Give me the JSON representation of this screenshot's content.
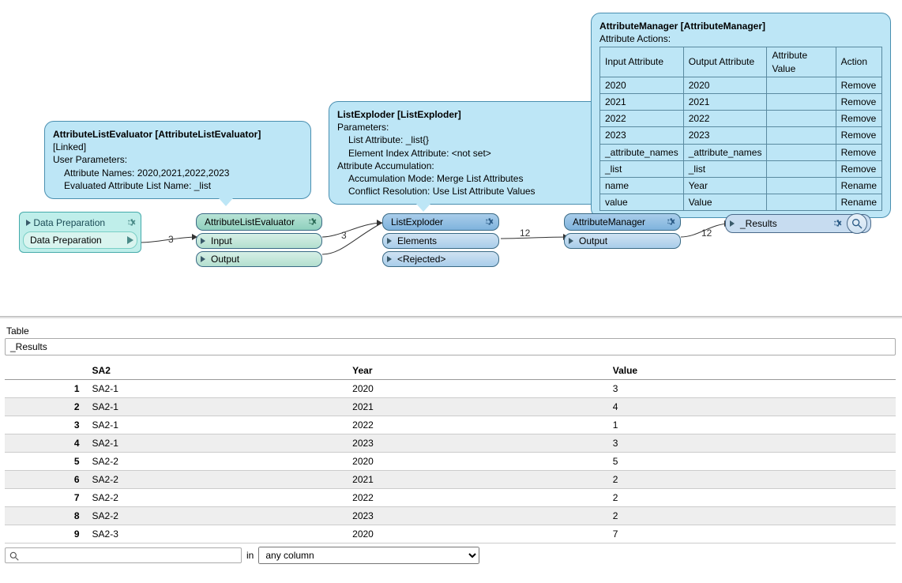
{
  "canvas": {
    "bookmark": {
      "title": "Data Preparation",
      "inner_label": "Data Preparation"
    },
    "ale": {
      "tooltip": {
        "title": "AttributeListEvaluator [AttributeListEvaluator]",
        "linked": "[Linked]",
        "hdr": "User Parameters:",
        "l1": "Attribute Names: 2020,2021,2022,2023",
        "l2": "Evaluated Attribute List Name: _list"
      },
      "title": "AttributeListEvaluator",
      "port_in": "Input",
      "port_out": "Output"
    },
    "le": {
      "tooltip": {
        "title": "ListExploder [ListExploder]",
        "p_hdr": "Parameters:",
        "p1": "List Attribute: _list{}",
        "p2": "Element Index Attribute: <not set>",
        "a_hdr": "Attribute Accumulation:",
        "a1": "Accumulation Mode: Merge List Attributes",
        "a2": "Conflict Resolution: Use List Attribute Values"
      },
      "title": "ListExploder",
      "port_elem": "Elements",
      "port_rej": "<Rejected>"
    },
    "am": {
      "tooltip": {
        "title": "AttributeManager [AttributeManager]",
        "sub": "Attribute Actions:",
        "cols": [
          "Input Attribute",
          "Output Attribute",
          "Attribute Value",
          "Action"
        ],
        "rows": [
          [
            "2020",
            "2020",
            "",
            "Remove"
          ],
          [
            "2021",
            "2021",
            "",
            "Remove"
          ],
          [
            "2022",
            "2022",
            "",
            "Remove"
          ],
          [
            "2023",
            "2023",
            "",
            "Remove"
          ],
          [
            "_attribute_names",
            "_attribute_names",
            "",
            "Remove"
          ],
          [
            "_list",
            "_list",
            "",
            "Remove"
          ],
          [
            "name",
            "Year",
            "",
            "Rename"
          ],
          [
            "value",
            "Value",
            "",
            "Rename"
          ]
        ]
      },
      "title": "AttributeManager",
      "port_out": "Output"
    },
    "results": {
      "title": "_Results"
    },
    "counts": {
      "c1": "3",
      "c2": "3",
      "c3": "12",
      "c4": "12"
    }
  },
  "tablepane": {
    "label": "Table",
    "dataset": "_Results",
    "columns": [
      "SA2",
      "Year",
      "Value"
    ],
    "rows": [
      [
        "SA2-1",
        "2020",
        "3"
      ],
      [
        "SA2-1",
        "2021",
        "4"
      ],
      [
        "SA2-1",
        "2022",
        "1"
      ],
      [
        "SA2-1",
        "2023",
        "3"
      ],
      [
        "SA2-2",
        "2020",
        "5"
      ],
      [
        "SA2-2",
        "2021",
        "2"
      ],
      [
        "SA2-2",
        "2022",
        "2"
      ],
      [
        "SA2-2",
        "2023",
        "2"
      ],
      [
        "SA2-3",
        "2020",
        "7"
      ]
    ],
    "search": {
      "placeholder": "",
      "in": "in",
      "select": "any column"
    }
  }
}
